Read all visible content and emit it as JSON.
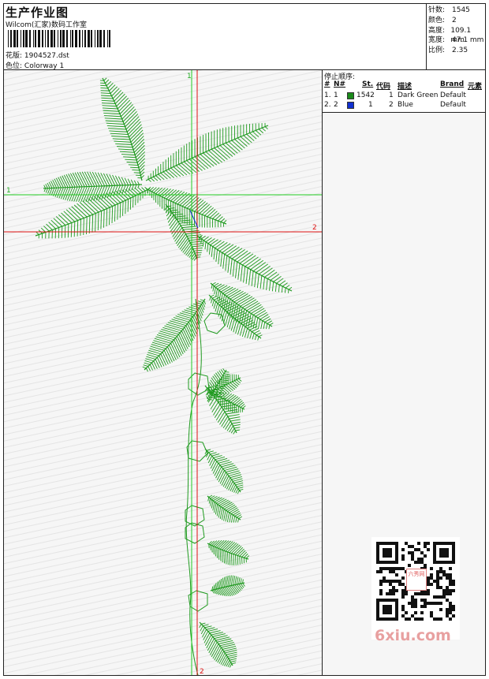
{
  "header": {
    "title": "生产作业图",
    "studio": "Wilcom(汇家)数码工作室",
    "file_label": "花版:",
    "file_name": "1904527.dst",
    "color_label": "色位:",
    "colorway": "Colorway 1"
  },
  "stats": [
    {
      "label": "针数:",
      "value": "1545"
    },
    {
      "label": "颜色:",
      "value": "2"
    },
    {
      "label": "高度:",
      "value": "109.1 mm"
    },
    {
      "label": "宽度:",
      "value": "47.1 mm"
    },
    {
      "label": "比例:",
      "value": "2.35"
    }
  ],
  "guides": {
    "green_label_top": "1",
    "green_label_left": "1",
    "red_label_right": "2",
    "red_label_bottom": "2"
  },
  "stop_sequence": {
    "title": "停止顺序:",
    "columns": [
      "#",
      "N#",
      "St.",
      "代码",
      "描述",
      "Brand",
      "元素"
    ],
    "rows": [
      {
        "index": "1.",
        "n": "1",
        "color": "#1a8a1a",
        "stitches": "1542",
        "code": "1",
        "description": "Dark Green",
        "brand": "Default"
      },
      {
        "index": "2.",
        "n": "2",
        "color": "#1030d0",
        "stitches": "1",
        "code": "2",
        "description": "Blue",
        "brand": "Default"
      }
    ]
  },
  "watermark": {
    "text": "6xiu.com",
    "badge": "六秀网"
  },
  "colors": {
    "thread_green": "#1f9a1f",
    "guide_green": "#22cc22",
    "guide_red": "#dd1111",
    "background": "#f6f6f6"
  }
}
